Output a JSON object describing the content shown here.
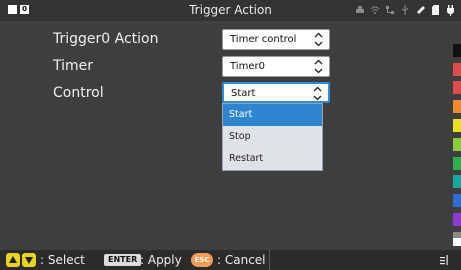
{
  "window": {
    "title": "Trigger Action"
  },
  "header": {
    "indicator_left": "",
    "indicator_right_label": "0",
    "status_icons": [
      "printer-icon",
      "wifi-icon",
      "network-icon",
      "usb-icon",
      "link-icon",
      "sd-card-icon",
      "power-plug-icon"
    ]
  },
  "form": {
    "rows": [
      {
        "label": "Trigger0  Action",
        "value": "Timer control"
      },
      {
        "label": "Timer",
        "value": "Timer0"
      },
      {
        "label": "Control",
        "value": "Start"
      }
    ]
  },
  "dropdown": {
    "options": [
      "Start",
      "Stop",
      "Restart"
    ],
    "selected": "Start"
  },
  "colors": {
    "background": "#3e3e3e",
    "accent": "#2f86cf",
    "key_yellow": "#e8d222",
    "esc_orange": "#f39a55",
    "side_bars": [
      "#111111",
      "#e04b4b",
      "#e04b4b",
      "#f08a2a",
      "#e8e020",
      "#8ccc3c",
      "#2fae4f",
      "#1aa7a0",
      "#2b6fd6",
      "#8a3ccf",
      "#8a8a8a",
      "#ffffff"
    ]
  },
  "footer": {
    "select_label": ": Select",
    "enter_key": "ENTER",
    "apply_label": ": Apply",
    "esc_key": "ESC",
    "cancel_label": ": Cancel"
  }
}
